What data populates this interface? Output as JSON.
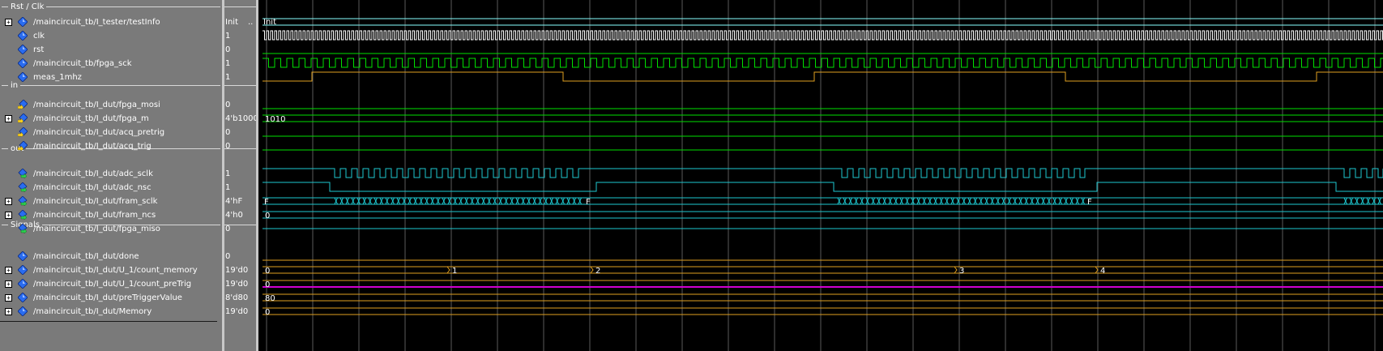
{
  "groups": {
    "rst_clk": "Rst / Clk",
    "in": "in",
    "out": "out",
    "signals": "Signals"
  },
  "signals": [
    {
      "name": "/maincircuit_tb/I_tester/testInfo",
      "value": "Init",
      "value_suffix": "..",
      "expandable": true,
      "icon": "bus-diamond-icon"
    },
    {
      "name": "clk",
      "value": "1",
      "expandable": false,
      "icon": "signal-diamond-icon"
    },
    {
      "name": "rst",
      "value": "0",
      "expandable": false,
      "icon": "signal-diamond-icon"
    },
    {
      "name": "/maincircuit_tb/fpga_sck",
      "value": "1",
      "expandable": false,
      "icon": "signal-diamond-icon"
    },
    {
      "name": "meas_1mhz",
      "value": "1",
      "expandable": false,
      "icon": "signal-diamond-icon"
    },
    {
      "name": "/maincircuit_tb/I_dut/fpga_mosi",
      "value": "0",
      "expandable": false,
      "icon": "input-port-icon"
    },
    {
      "name": "/maincircuit_tb/I_dut/fpga_m",
      "value": "4'b1000",
      "expandable": true,
      "icon": "input-port-icon"
    },
    {
      "name": "/maincircuit_tb/I_dut/acq_pretrig",
      "value": "0",
      "expandable": false,
      "icon": "input-port-icon"
    },
    {
      "name": "/maincircuit_tb/I_dut/acq_trig",
      "value": "0",
      "expandable": false,
      "icon": "input-port-icon"
    },
    {
      "name": "/maincircuit_tb/I_dut/adc_sclk",
      "value": "1",
      "expandable": false,
      "icon": "output-port-icon"
    },
    {
      "name": "/maincircuit_tb/I_dut/adc_nsc",
      "value": "1",
      "expandable": false,
      "icon": "output-port-icon"
    },
    {
      "name": "/maincircuit_tb/I_dut/fram_sclk",
      "value": "4'hF",
      "expandable": true,
      "icon": "output-port-icon"
    },
    {
      "name": "/maincircuit_tb/I_dut/fram_ncs",
      "value": "4'h0",
      "expandable": true,
      "icon": "output-port-icon"
    },
    {
      "name": "/maincircuit_tb/I_dut/fpga_miso",
      "value": "0",
      "expandable": false,
      "icon": "output-port-icon"
    },
    {
      "name": "/maincircuit_tb/I_dut/done",
      "value": "0",
      "expandable": false,
      "icon": "signal-diamond-icon"
    },
    {
      "name": "/maincircuit_tb/I_dut/U_1/count_memory",
      "value": "19'd0",
      "expandable": true,
      "icon": "signal-diamond-icon"
    },
    {
      "name": "/maincircuit_tb/I_dut/U_1/count_preTrig",
      "value": "19'd0",
      "expandable": true,
      "icon": "signal-diamond-icon"
    },
    {
      "name": "/maincircuit_tb/I_dut/preTriggerValue",
      "value": "8'd80",
      "expandable": true,
      "icon": "signal-diamond-icon"
    },
    {
      "name": "/maincircuit_tb/I_dut/Memory",
      "value": "19'd0",
      "expandable": true,
      "icon": "signal-diamond-icon"
    }
  ],
  "wave_labels": {
    "testInfo": "Init",
    "fpga_m": "1010",
    "fram_sclk_start": "F",
    "fram_sclk_mid": "F",
    "fram_sclk_end": "F",
    "fram_ncs": "0",
    "count_memory_0": "0",
    "count_memory_1": "1",
    "count_memory_2": "2",
    "count_memory_3": "3",
    "count_memory_4": "4",
    "count_preTrig": "0",
    "preTriggerValue": "80",
    "memory": "0"
  },
  "colors": {
    "panel_bg": "#7a7a7a",
    "wave_bg": "#000000",
    "grid": "#5a5a5a",
    "green_wave": "#00e000",
    "cyan_wave": "#1ec8d0",
    "orange_wave": "#e0a020",
    "magenta_wave": "#d000d0",
    "expand_plus": "+"
  }
}
